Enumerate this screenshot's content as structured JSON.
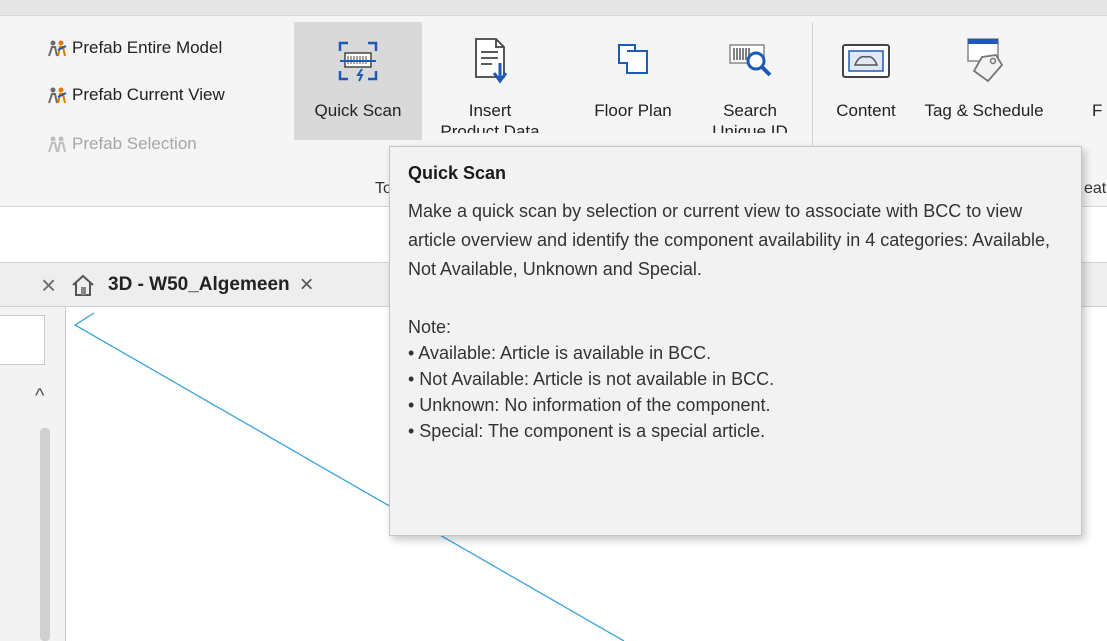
{
  "ribbon": {
    "prefab_items": [
      {
        "label": "Prefab Entire Model",
        "enabled": true
      },
      {
        "label": "Prefab Current View",
        "enabled": true
      },
      {
        "label": "Prefab Selection",
        "enabled": false
      }
    ],
    "buttons": {
      "quick_scan": {
        "label": "Quick Scan",
        "icon": "quick-scan-icon"
      },
      "insert_product_data": {
        "label": "Insert",
        "label2": "Product Data",
        "icon": "insert-document-icon"
      },
      "floor_plan": {
        "label": "Floor Plan",
        "icon": "floor-plan-icon"
      },
      "search_unique_id": {
        "label": "Search",
        "label2": "Unique ID",
        "icon": "barcode-search-icon"
      },
      "content": {
        "label": "Content",
        "icon": "content-icon"
      },
      "tag_schedule": {
        "label": "Tag & Schedule",
        "icon": "tag-icon"
      },
      "next_partial": {
        "label": "F"
      }
    },
    "group_labels": {
      "tools": "To",
      "create": "eat"
    }
  },
  "view_tab": {
    "title": "3D - W50_Algemeen",
    "icon": "home-icon",
    "close": "×"
  },
  "left_close": "×",
  "scroll_up_glyph": "^",
  "tooltip": {
    "title": "Quick Scan",
    "body": "Make a quick scan by selection or current view to associate with BCC to view article overview and identify the component availability in 4 categories: Available, Not Available, Unknown and Special.",
    "note_title": "Note:",
    "notes": [
      "• Available: Article is available in BCC.",
      "• Not Available: Article is not available in BCC.",
      "• Unknown: No information of the component.",
      "• Special: The component is a special article."
    ]
  },
  "colors": {
    "ribbon_bg": "#f5f5f5",
    "active_button_bg": "#d9d9d9",
    "tooltip_bg": "#f2f2f2",
    "model_line": "#3aa3d9",
    "icon_blue": "#1e5bb8"
  }
}
